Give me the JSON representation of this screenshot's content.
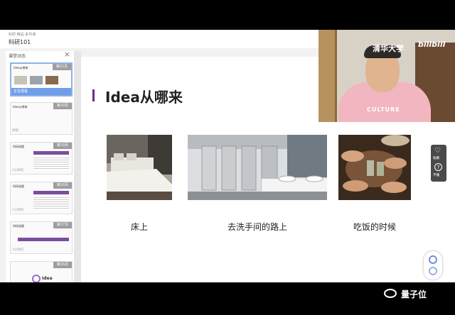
{
  "top_bar": {
    "small_text": "科研 精品 系列课",
    "title": "科研101"
  },
  "sidebar": {
    "header": "课堂动态",
    "thumbnails": [
      {
        "title": "Idea从哪来",
        "page": "第21页",
        "status": "正在观看",
        "active": true
      },
      {
        "title": "Idea从哪来",
        "page": "第20页",
        "status": "刚刚"
      },
      {
        "title": "科研选题",
        "page": "第19页",
        "status": "2分钟前"
      },
      {
        "title": "科研选题",
        "page": "第18页",
        "status": "2分钟前"
      },
      {
        "title": "科研选题",
        "page": "第17页",
        "status": "3分钟前"
      },
      {
        "title": "Idea",
        "page": "第16页"
      }
    ]
  },
  "slide": {
    "title": "Idea从哪来",
    "photos": [
      {
        "caption": "床上"
      },
      {
        "caption": "去洗手间的路上"
      },
      {
        "caption": "吃饭的时候"
      }
    ]
  },
  "video": {
    "school_text": "清华大学",
    "brand_text": "bilibili",
    "shirt_text": "CULTURE"
  },
  "side_panel": {
    "favorite_label": "收藏",
    "question_label": "不懂"
  },
  "watermark": "量子位",
  "colors": {
    "accent_purple": "#6e2b8a",
    "active_blue": "#6f9ee8"
  }
}
